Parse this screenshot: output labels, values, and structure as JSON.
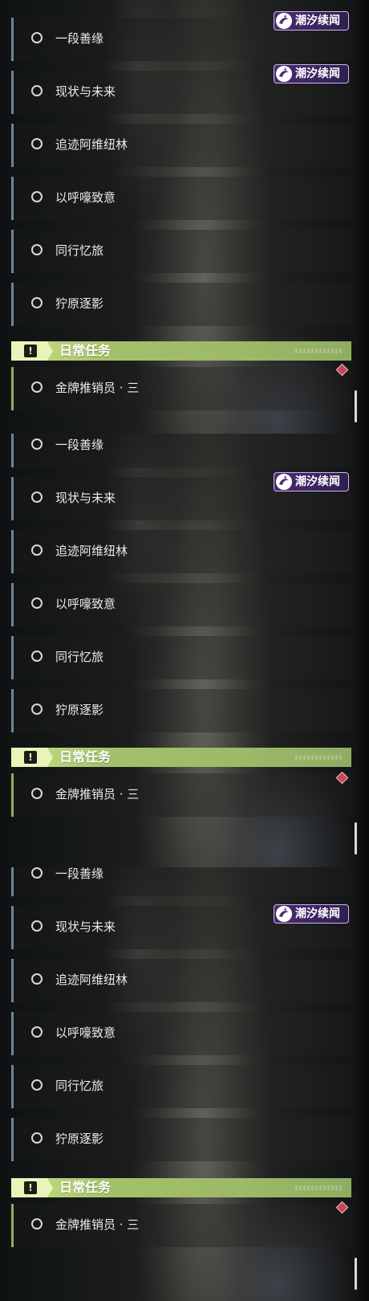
{
  "tag_label": "潮汐续闻",
  "quests": [
    "一段善缘",
    "现状与未来",
    "追迹阿维纽林",
    "以呼嚎致意",
    "同行忆旅",
    "狞原逐影"
  ],
  "daily": {
    "header": "日常任务",
    "header_icon": "!",
    "task": "金牌推销员 · 三"
  },
  "colors": {
    "tag_bg": "#4b2c73",
    "header_green": "#a3c06a",
    "quest_accent": "#6d8692",
    "daily_accent": "#8fae5c",
    "marker_red": "#c8445b"
  },
  "icons": [
    "tide-logo-icon",
    "exclamation-icon",
    "quest-circle-icon",
    "tracking-diamond-icon"
  ]
}
